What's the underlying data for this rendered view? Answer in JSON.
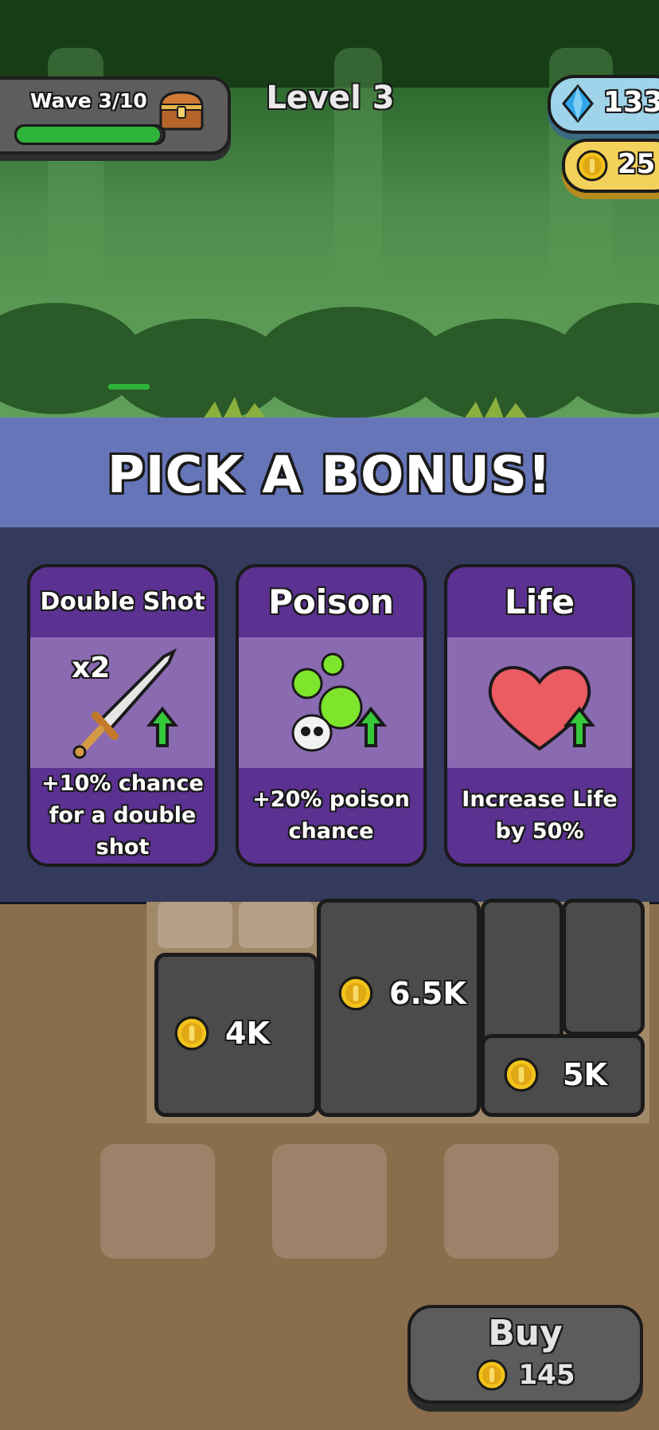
{
  "hud": {
    "wave_label": "Wave 3/10",
    "wave_progress": 0.98,
    "level_title": "Level 3",
    "gems": "133",
    "coins": "25"
  },
  "bonus": {
    "title": "PICK A BONUS!",
    "cards": [
      {
        "title": "Double Shot",
        "icon": "sword-icon",
        "badge": "x2",
        "description": "+10% chance for a double shot"
      },
      {
        "title": "Poison",
        "icon": "poison-skull-icon",
        "description": "+20% poison chance"
      },
      {
        "title": "Life",
        "icon": "heart-icon",
        "description": "Increase Life by 50%"
      }
    ]
  },
  "board": {
    "blocks": [
      {
        "price": "4K"
      },
      {
        "price": "6.5K"
      },
      {
        "price": "5K"
      }
    ]
  },
  "buy": {
    "label": "Buy",
    "cost": "145"
  },
  "colors": {
    "banner": "#6674b8",
    "card": "#5b3191",
    "upgrade_arrow": "#35c93a",
    "coin": "#f2c31b",
    "gem": "#2ea6e8"
  }
}
